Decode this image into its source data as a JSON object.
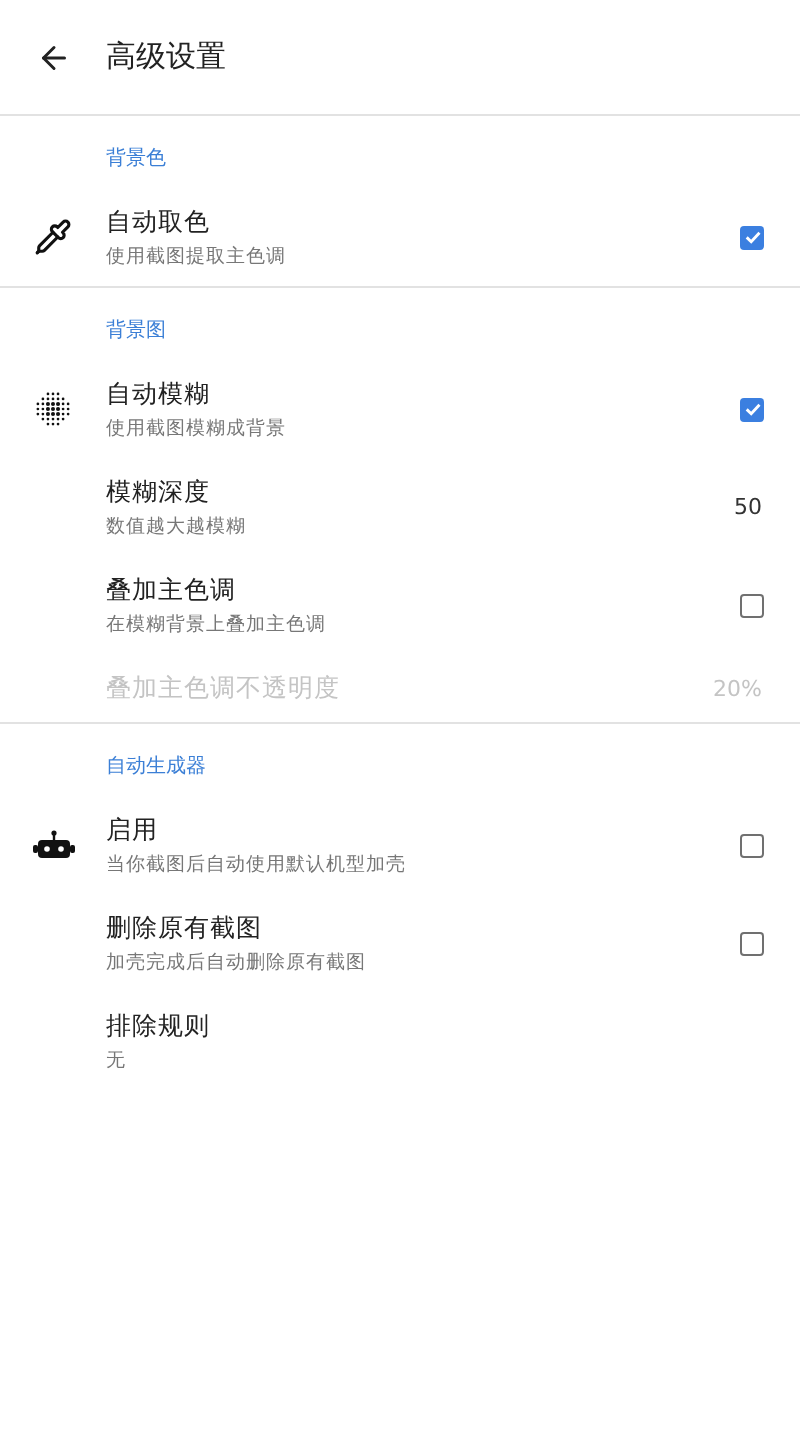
{
  "app_bar": {
    "title": "高级设置"
  },
  "sections": [
    {
      "header": "背景色",
      "items": [
        {
          "kind": "checkbox",
          "title": "自动取色",
          "subtitle": "使用截图提取主色调",
          "checked": true
        }
      ]
    },
    {
      "header": "背景图",
      "items": [
        {
          "kind": "checkbox",
          "title": "自动模糊",
          "subtitle": "使用截图模糊成背景",
          "checked": true
        },
        {
          "kind": "value",
          "title": "模糊深度",
          "subtitle": "数值越大越模糊",
          "value": "50"
        },
        {
          "kind": "checkbox",
          "title": "叠加主色调",
          "subtitle": "在模糊背景上叠加主色调",
          "checked": false
        },
        {
          "kind": "value",
          "title": "叠加主色调不透明度",
          "value": "20%",
          "disabled": true
        }
      ]
    },
    {
      "header": "自动生成器",
      "items": [
        {
          "kind": "checkbox",
          "title": "启用",
          "subtitle": "当你截图后自动使用默认机型加壳",
          "checked": false
        },
        {
          "kind": "checkbox",
          "title": "删除原有截图",
          "subtitle": "加壳完成后自动删除原有截图",
          "checked": false
        },
        {
          "kind": "plain",
          "title": "排除规则",
          "subtitle": "无"
        }
      ]
    }
  ]
}
